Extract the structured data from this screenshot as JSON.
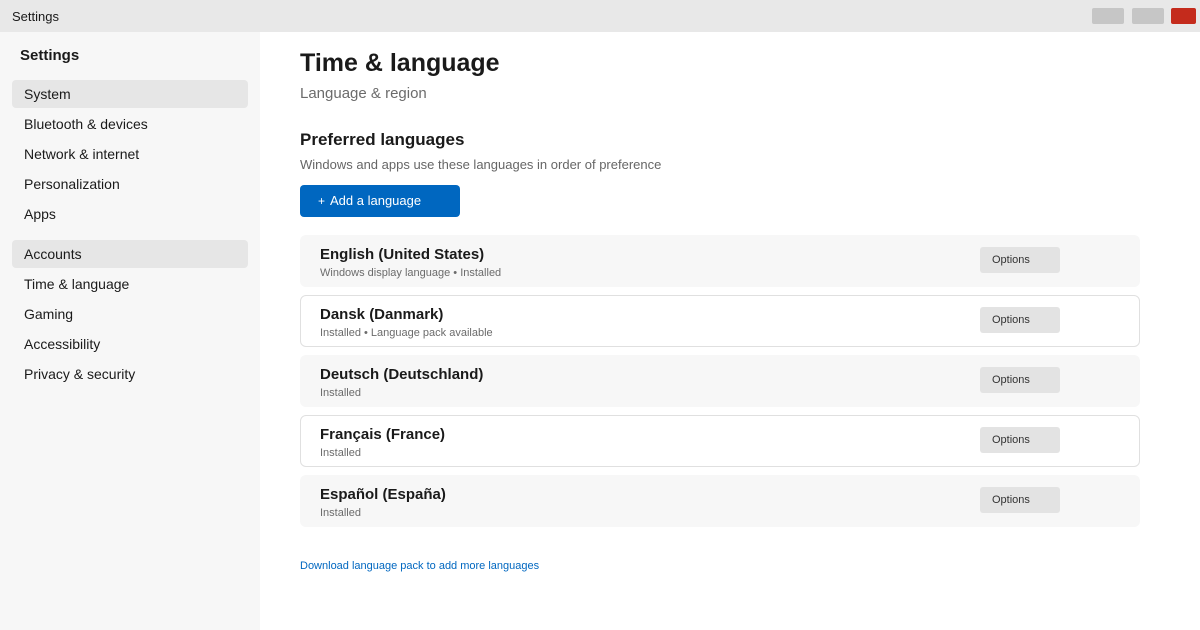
{
  "window": {
    "title": "Settings"
  },
  "sidebar": {
    "heading": "Settings",
    "items": [
      {
        "label": "System",
        "selected": true
      },
      {
        "label": "Bluetooth & devices",
        "selected": false
      },
      {
        "label": "Network & internet",
        "selected": false
      },
      {
        "label": "Personalization",
        "selected": false
      },
      {
        "label": "Apps",
        "selected": false
      },
      {
        "label": "Accounts",
        "selected": true
      },
      {
        "label": "Time & language",
        "selected": false
      },
      {
        "label": "Gaming",
        "selected": false
      },
      {
        "label": "Accessibility",
        "selected": false
      },
      {
        "label": "Privacy & security",
        "selected": false
      }
    ]
  },
  "main": {
    "title": "Time & language",
    "subtitle": "Language & region",
    "section_title": "Preferred languages",
    "section_description": "Windows and apps use these languages in order of preference",
    "add_button": {
      "icon": "+",
      "label": "Add a language"
    },
    "languages": [
      {
        "name": "English (United States)",
        "status": "Windows display language • Installed",
        "options_label": "Options"
      },
      {
        "name": "Dansk (Danmark)",
        "status": "Installed • Language pack available",
        "options_label": "Options"
      },
      {
        "name": "Deutsch (Deutschland)",
        "status": "Installed",
        "options_label": "Options"
      },
      {
        "name": "Français (France)",
        "status": "Installed",
        "options_label": "Options"
      },
      {
        "name": "Español (España)",
        "status": "Installed",
        "options_label": "Options"
      }
    ],
    "download_link": "Download language pack to add more languages"
  },
  "colors": {
    "accent": "#0067c0",
    "close_button": "#c42b1c",
    "sidebar_bg": "#f7f7f7",
    "titlebar_bg": "#e8e8e8"
  }
}
